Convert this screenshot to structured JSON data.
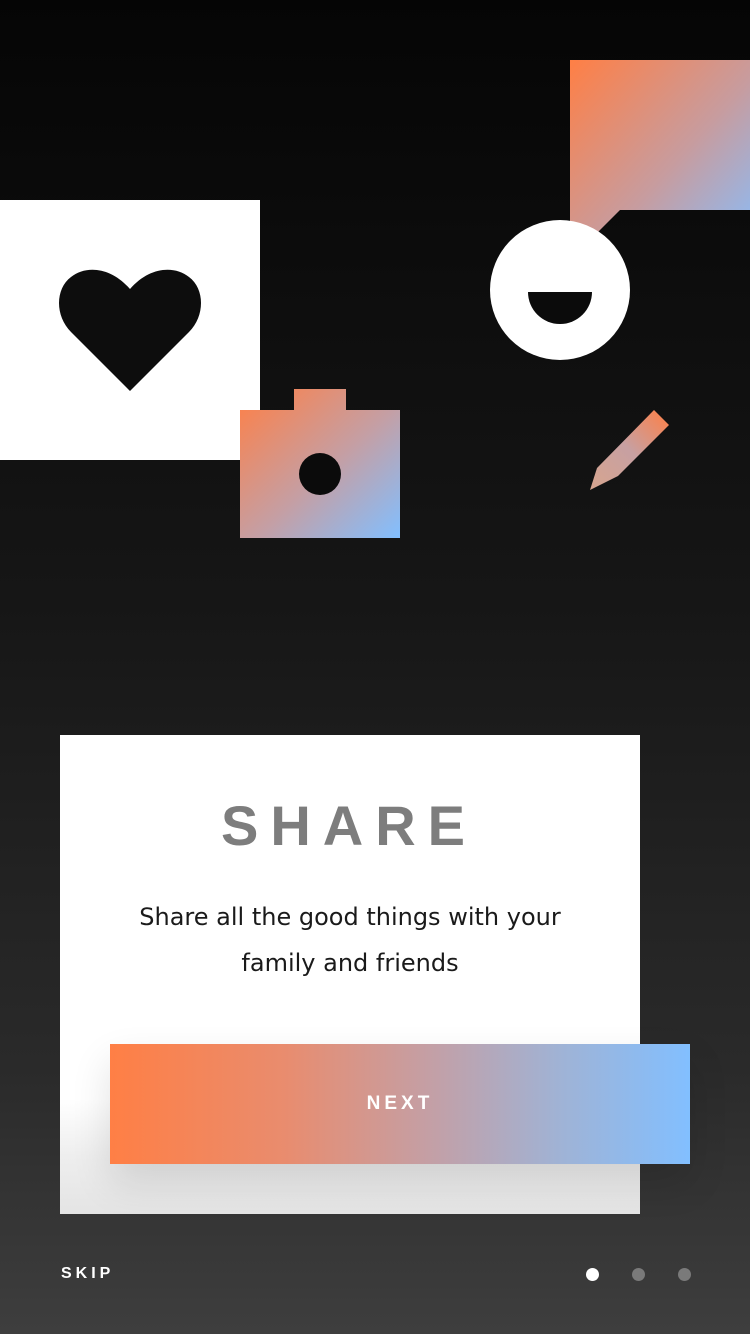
{
  "onboarding": {
    "title": "SHARE",
    "description_line1": "Share all the good things with your",
    "description_line2": "family and friends",
    "next_label": "NEXT",
    "skip_label": "SKIP",
    "page_indicator": {
      "total": 3,
      "current": 1
    }
  },
  "illustration": {
    "icons": [
      "heart-icon",
      "camera-icon",
      "chat-bubble-icon",
      "smiley-icon",
      "pencil-icon"
    ]
  },
  "colors": {
    "background_top": "#050505",
    "background_bottom": "#3e3e3e",
    "accent_orange": "#ff7f45",
    "accent_blue": "#82bfff",
    "title_gray": "#7d7d7d"
  }
}
